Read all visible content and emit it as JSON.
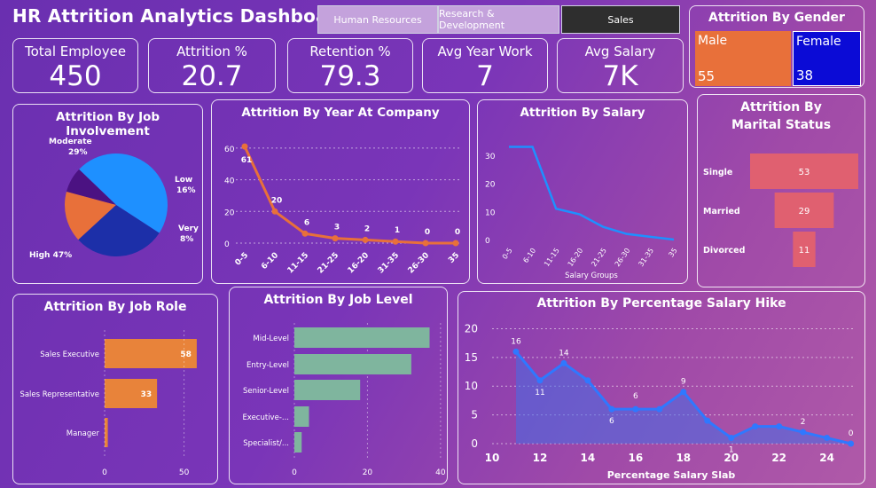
{
  "header": {
    "title": "HR Attrition Analytics Dashboard"
  },
  "tabs": [
    {
      "label": "Human Resources",
      "active": false
    },
    {
      "label": "Research & Development",
      "active": false
    },
    {
      "label": "Sales",
      "active": true
    }
  ],
  "kpis": [
    {
      "label": "Total Employee",
      "value": "450"
    },
    {
      "label": "Attrition %",
      "value": "20.7"
    },
    {
      "label": "Retention %",
      "value": "79.3"
    },
    {
      "label": "Avg Year Work",
      "value": "7"
    },
    {
      "label": "Avg Salary",
      "value": "7K"
    }
  ],
  "gender": {
    "title": "Attrition By Gender",
    "male_label": "Male",
    "male_value": "55",
    "female_label": "Female",
    "female_value": "38",
    "male_color": "#e8703a",
    "female_color": "#0b0bd6"
  },
  "job_involvement": {
    "title": "Attrition By Job Involvement"
  },
  "year_company": {
    "title": "Attrition By Year At Company"
  },
  "salary": {
    "title": "Attrition By Salary"
  },
  "marital": {
    "title": "Attrition By Marital Status"
  },
  "job_role": {
    "title": "Attrition By Job Role"
  },
  "job_level": {
    "title": "Attrition By Job Level"
  },
  "hike": {
    "title": "Attrition By Percentage Salary Hike"
  },
  "chart_data": [
    {
      "type": "pie",
      "title": "Attrition By Job Involvement",
      "slices": [
        {
          "label": "High",
          "value": 47,
          "text": "High 47%",
          "color": "#1e90ff"
        },
        {
          "label": "Very",
          "value": 8,
          "text": "Very 8%",
          "color": "#4b1282"
        },
        {
          "label": "Low",
          "value": 16,
          "text": "Low 16%",
          "color": "#e8703a"
        },
        {
          "label": "Moderate",
          "value": 29,
          "text": "Moderate 29%",
          "color": "#1c2fa8"
        }
      ]
    },
    {
      "type": "line",
      "title": "Attrition By Year At Company",
      "categories": [
        "0-5",
        "6-10",
        "11-15",
        "21-25",
        "16-20",
        "31-35",
        "26-30",
        "35"
      ],
      "values": [
        61,
        20,
        6,
        3,
        2,
        1,
        0,
        0
      ],
      "yticks": [
        0,
        20,
        40,
        60
      ],
      "ylim": [
        0,
        65
      ],
      "color": "#e8703a"
    },
    {
      "type": "line",
      "title": "Attrition By Salary",
      "categories": [
        "0-5",
        "6-10",
        "11-15",
        "16-20",
        "21-25",
        "26-30",
        "31-35",
        "35"
      ],
      "values": [
        33,
        33,
        11,
        9,
        4.5,
        2,
        1,
        0
      ],
      "yticks": [
        0,
        10,
        20,
        30
      ],
      "ylim": [
        0,
        36
      ],
      "xlabel": "Salary Groups",
      "color": "#1e90ff"
    },
    {
      "type": "bar",
      "title": "Attrition By Marital Status",
      "categories": [
        "Single",
        "Married",
        "Divorced"
      ],
      "values": [
        53,
        29,
        11
      ],
      "color": "#e06070"
    },
    {
      "type": "bar",
      "title": "Attrition By Job Role",
      "categories": [
        "Sales Executive",
        "Sales Representative",
        "Manager"
      ],
      "values": [
        58,
        33,
        2
      ],
      "show_labels": [
        true,
        true,
        false
      ],
      "xticks": [
        0,
        50
      ],
      "xlim": [
        0,
        72
      ],
      "color": "#e8833a"
    },
    {
      "type": "bar",
      "title": "Attrition By Job Level",
      "categories": [
        "Mid-Level",
        "Entry-Level",
        "Senior-Level",
        "Executive-...",
        "Specialist/..."
      ],
      "values": [
        37,
        32,
        18,
        4,
        2
      ],
      "xticks": [
        0,
        20,
        40
      ],
      "xlim": [
        0,
        41
      ],
      "color": "#7fb59e"
    },
    {
      "type": "area",
      "title": "Attrition By Percentage Salary Hike",
      "x": [
        11,
        12,
        13,
        14,
        15,
        16,
        17,
        18,
        19,
        20,
        21,
        22,
        23,
        24,
        25
      ],
      "y": [
        16,
        11,
        14,
        11,
        6,
        6,
        6,
        9,
        4,
        1,
        3,
        3,
        2,
        1,
        0
      ],
      "labels": [
        "16",
        "11",
        "14",
        "",
        "6",
        "6",
        "",
        "9",
        "",
        "1",
        "",
        "",
        "2",
        "",
        "0"
      ],
      "xticks": [
        10,
        12,
        14,
        16,
        18,
        20,
        22,
        24
      ],
      "yticks": [
        0,
        5,
        10,
        15,
        20
      ],
      "xlim": [
        10,
        25.2
      ],
      "ylim": [
        0,
        21
      ],
      "xlabel": "Percentage Salary Slab",
      "color": "#2f78ff"
    }
  ]
}
